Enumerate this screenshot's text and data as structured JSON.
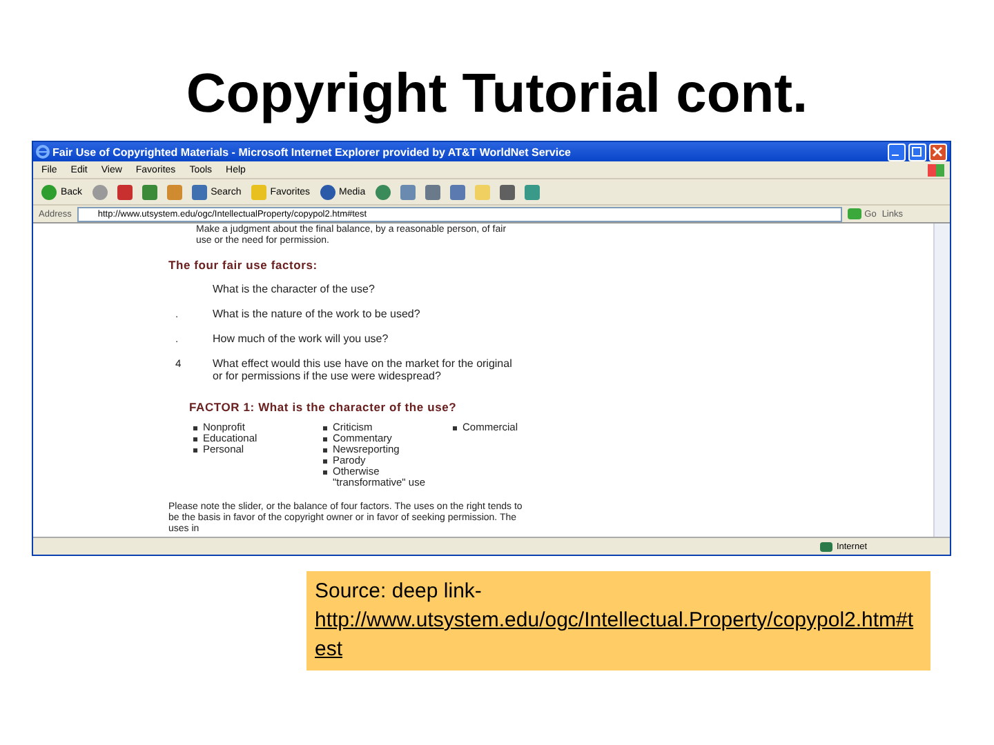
{
  "slide": {
    "title": "Copyright Tutorial cont."
  },
  "browser": {
    "title": "Fair Use of Copyrighted Materials - Microsoft Internet Explorer provided by AT&T WorldNet Service",
    "menu": [
      "File",
      "Edit",
      "View",
      "Favorites",
      "Tools",
      "Help"
    ],
    "toolbar": [
      {
        "kind": "back",
        "label": "Back"
      },
      {
        "kind": "forward"
      },
      {
        "kind": "stop"
      },
      {
        "kind": "refresh"
      },
      {
        "kind": "home"
      },
      {
        "kind": "search",
        "label": "Search"
      },
      {
        "kind": "favorites",
        "label": "Favorites"
      },
      {
        "kind": "media",
        "label": "Media"
      },
      {
        "kind": "history"
      },
      {
        "kind": "mail"
      },
      {
        "kind": "print"
      },
      {
        "kind": "edit"
      },
      {
        "kind": "folder"
      },
      {
        "kind": "messenger"
      },
      {
        "kind": "people"
      }
    ],
    "address": {
      "label": "Address",
      "value": "http://www.utsystem.edu/ogc/IntellectualProperty/copypol2.htm#test",
      "go": "Go",
      "links": "Links"
    },
    "page": {
      "intro": "Make a judgment about the final balance, by a reasonable person, of fair use or the need for permission.",
      "factors_heading": "The four fair use factors:",
      "factors": [
        {
          "text": "What is the character of the use?"
        },
        {
          "marker": ".",
          "text": "What is the nature of the work to be used?"
        },
        {
          "marker": ".",
          "text": "How much of the work will you use?"
        },
        {
          "marker": "4",
          "text": "What effect would this use have on the market for the original or for permissions if the use were widespread?"
        }
      ],
      "factor1_heading": "FACTOR 1: What is the character of the use?",
      "columns": [
        [
          "Nonprofit",
          "Educational",
          "Personal"
        ],
        [
          "Criticism",
          "Commentary",
          "Newsreporting",
          "Parody",
          "Otherwise \"transformative\" use"
        ],
        [
          "Commercial"
        ]
      ],
      "note": "Please note the slider, or the balance of four factors. The uses on the right tends to be the basis in favor of the copyright owner or in favor of seeking permission. The uses in"
    },
    "status": {
      "zone": "Internet"
    }
  },
  "caption": {
    "label": "Source: deep link-",
    "link": "http://www.utsystem.edu/ogc/Intellectual.Property/copypol2.htm#test"
  }
}
